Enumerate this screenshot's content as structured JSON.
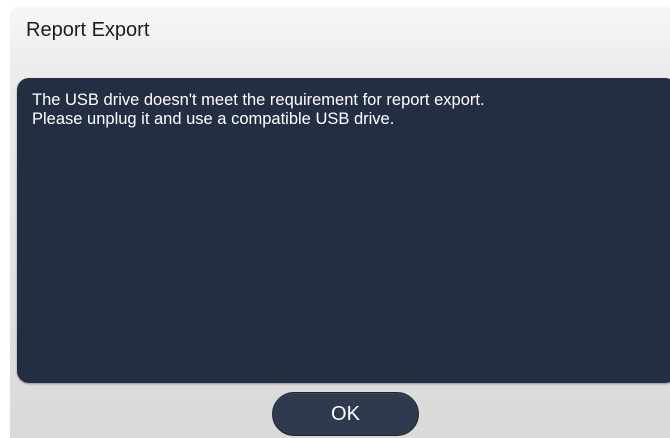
{
  "dialog": {
    "title": "Report Export",
    "message_lines": [
      "The USB drive doesn't meet the requirement for report export.",
      "Please unplug it and use a compatible USB drive."
    ],
    "ok_label": "OK"
  },
  "colors": {
    "panel_background": "#242e42",
    "button_background": "#2f3a4e",
    "message_text": "#ffffff"
  }
}
